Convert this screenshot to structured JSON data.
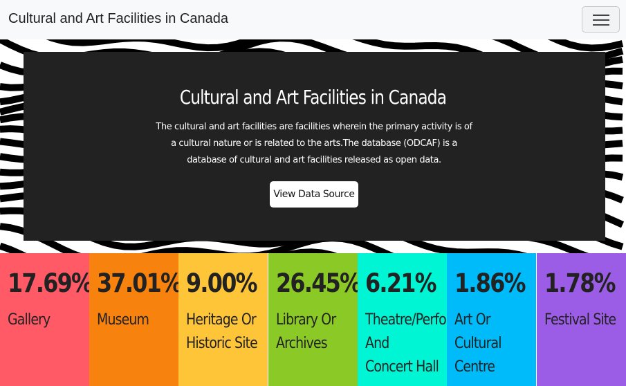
{
  "navbar": {
    "brand": "Cultural and Art Facilities in Canada",
    "toggle_icon": "hamburger-menu-icon"
  },
  "hero": {
    "title": "Cultural and Art Facilities in Canada",
    "description": "The cultural and art facilities are facilities wherein the primary activity is of a cultural nature or is related to the arts.The database (ODCAF) is a database of cultural and art facilities released as open data.",
    "button_label": "View Data Source"
  },
  "stats": [
    {
      "percent": "17.69%",
      "label": "Gallery",
      "color": "#ff5a66"
    },
    {
      "percent": "37.01%",
      "label": "Museum",
      "color": "#f7820d"
    },
    {
      "percent": "9.00%",
      "label": "Heritage Or Historic Site",
      "color": "#ffc539"
    },
    {
      "percent": "26.45%",
      "label": "Library Or Archives",
      "color": "#8ac926"
    },
    {
      "percent": "6.21%",
      "label": "Theatre/Performance And Concert Hall",
      "color": "#00f5d4"
    },
    {
      "percent": "1.86%",
      "label": "Art Or Cultural Centre",
      "color": "#00bbf9"
    },
    {
      "percent": "1.78%",
      "label": "Festival Site",
      "color": "#9b5de5"
    }
  ]
}
